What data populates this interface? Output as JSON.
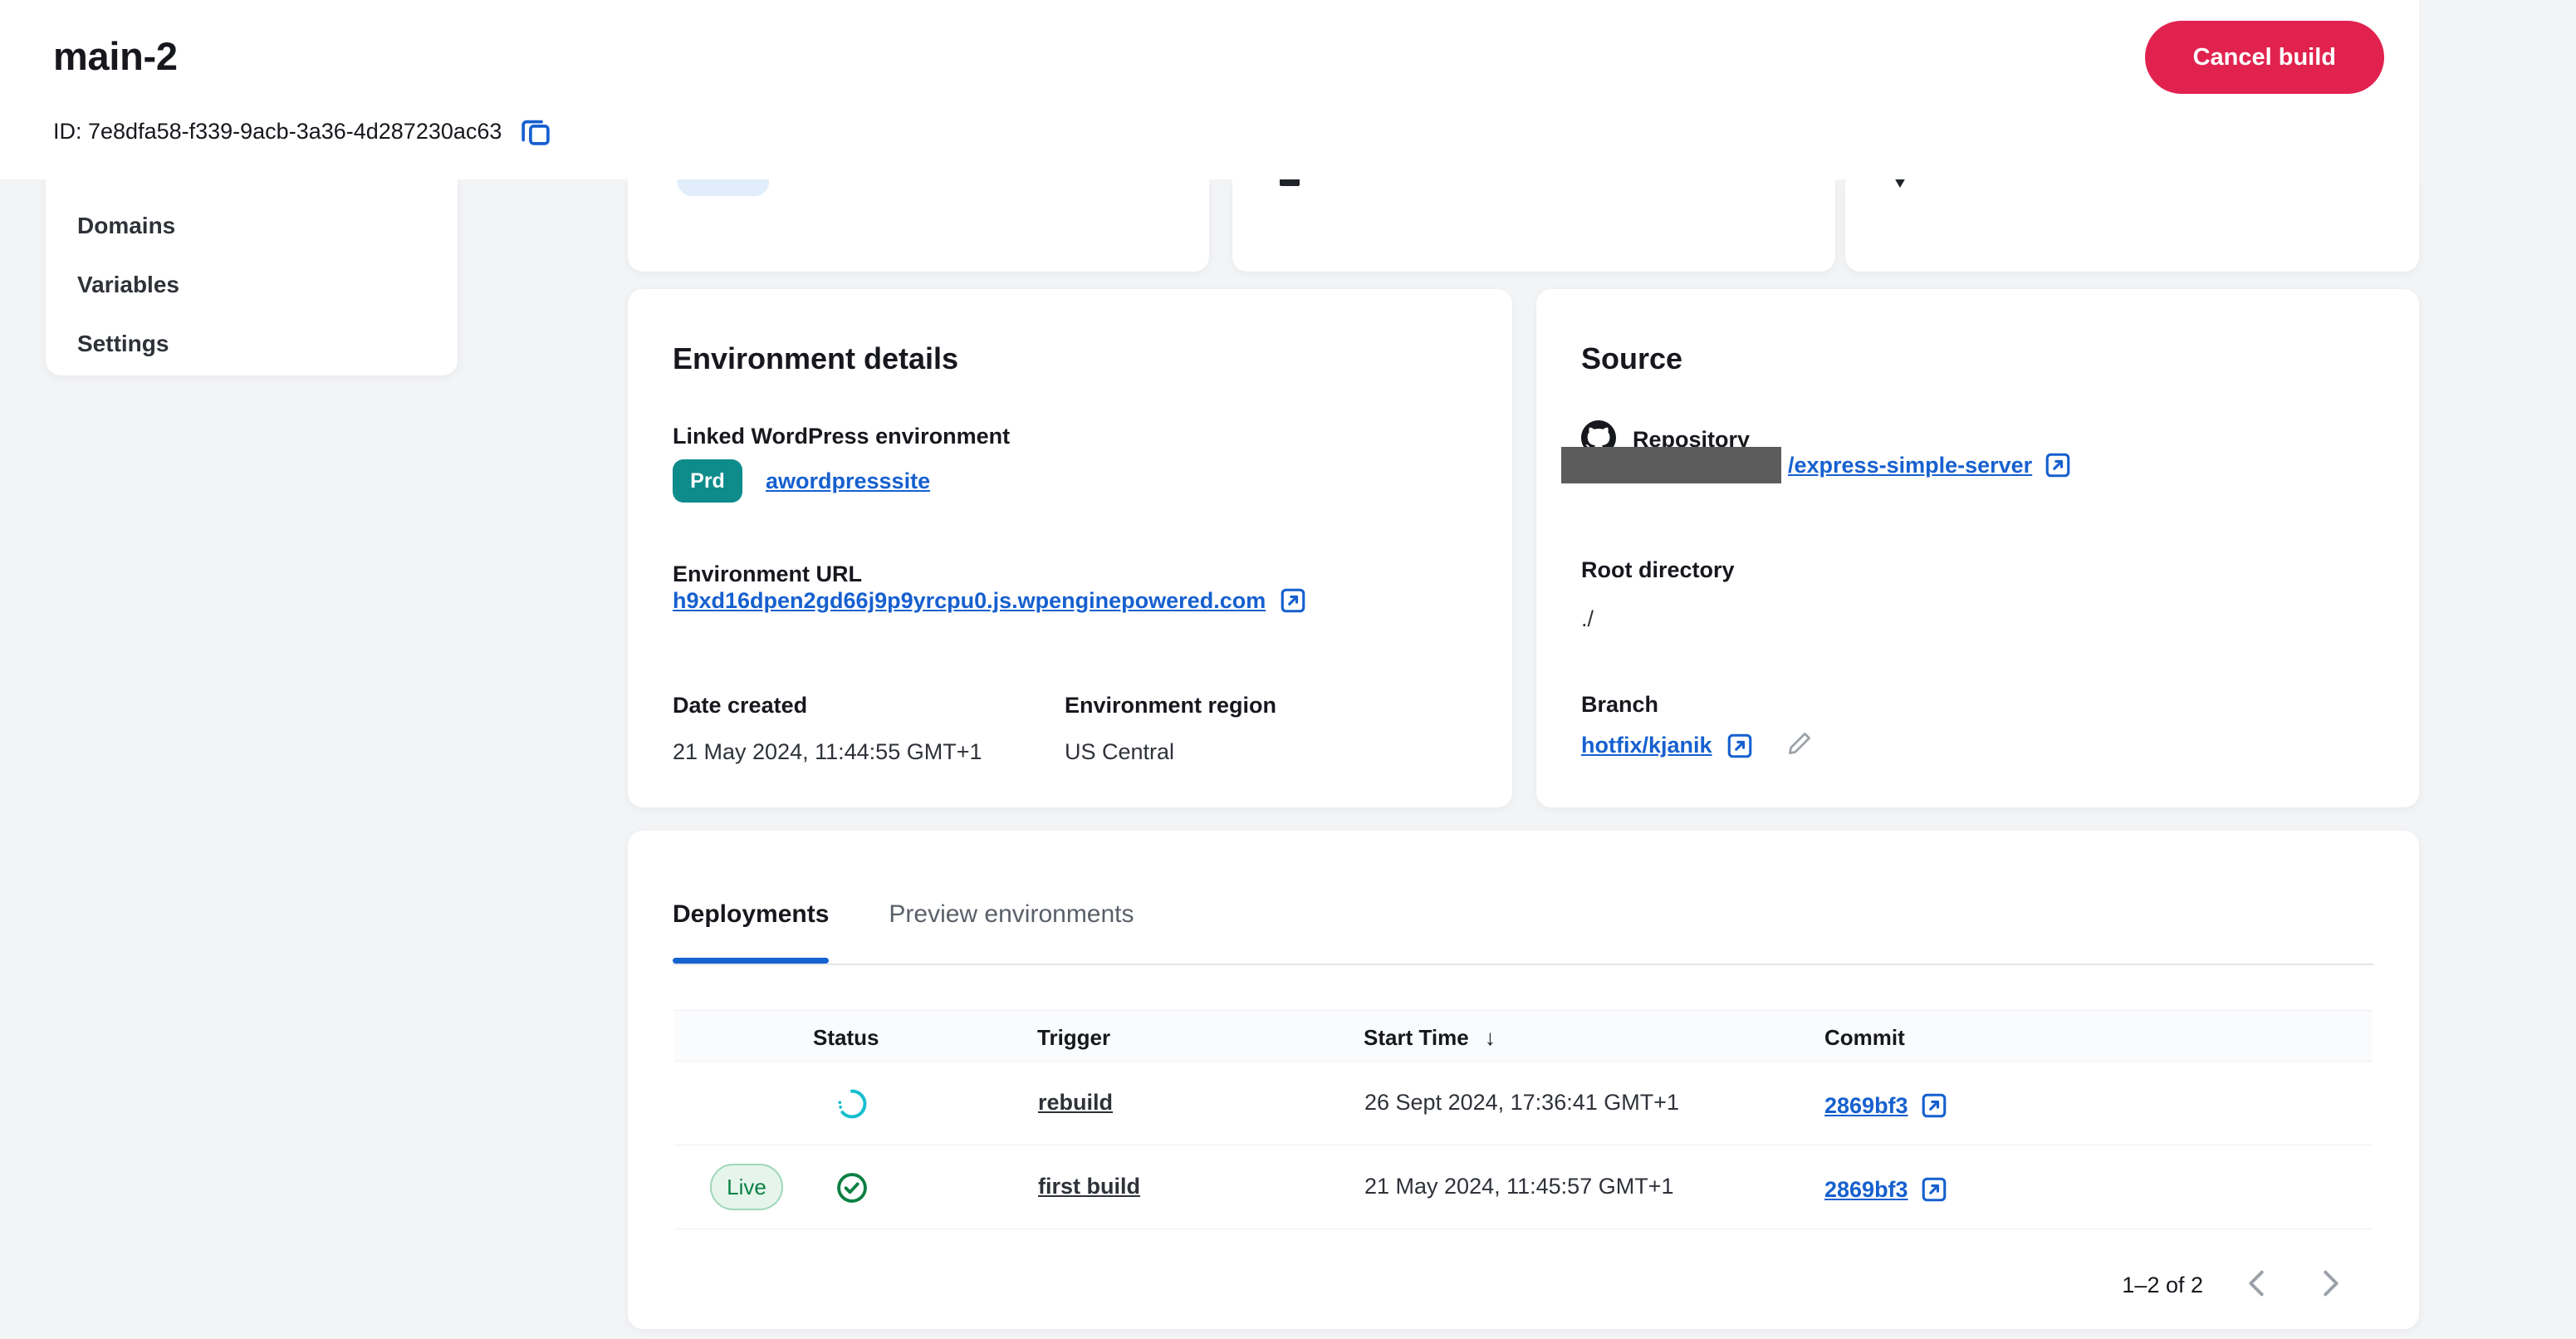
{
  "header": {
    "title": "main-2",
    "id_text": "ID: 7e8dfa58-f339-9acb-3a36-4d287230ac63",
    "copy_icon": "copy-icon",
    "cancel_label": "Cancel build"
  },
  "sidebar": {
    "items": [
      {
        "label": "Domains"
      },
      {
        "label": "Variables"
      },
      {
        "label": "Settings"
      }
    ]
  },
  "environment_details": {
    "title": "Environment details",
    "linked_wp_label": "Linked WordPress environment",
    "linked_wp_badge": "Prd",
    "linked_wp_site": "awordpresssite",
    "env_url_label": "Environment URL",
    "env_url": "h9xd16dpen2gd66j9p9yrcpu0.js.wpenginepowered.com",
    "date_created_label": "Date created",
    "date_created": "21 May 2024, 11:44:55 GMT+1",
    "region_label": "Environment region",
    "region": "US Central"
  },
  "source": {
    "title": "Source",
    "repository_label": "Repository",
    "repo_icon": "github-icon",
    "repo_owner_redacted": "",
    "repo_name": "/express-simple-server",
    "root_directory_label": "Root directory",
    "root_directory": "./",
    "branch_label": "Branch",
    "branch": "hotfix/kjanik",
    "edit_icon": "pencil-icon"
  },
  "deployments_panel": {
    "tabs": [
      {
        "label": "Deployments",
        "active": true
      },
      {
        "label": "Preview environments",
        "active": false
      }
    ],
    "columns": [
      "",
      "Status",
      "Trigger",
      "Start Time",
      "Commit"
    ],
    "sort_indicator": "↓",
    "rows": [
      {
        "live_badge": "",
        "status_icon": "spinner-icon",
        "trigger": "rebuild",
        "start_time": "26 Sept 2024, 17:36:41 GMT+1",
        "commit": "2869bf3"
      },
      {
        "live_badge": "Live",
        "status_icon": "check-circle-icon",
        "trigger": "first build",
        "start_time": "21 May 2024, 11:45:57 GMT+1",
        "commit": "2869bf3"
      }
    ],
    "pagination": {
      "range": "1–2 of 2",
      "prev_icon": "chevron-left-icon",
      "next_icon": "chevron-right-icon"
    }
  },
  "colors": {
    "accent_blue": "#1660cf",
    "danger": "#e1224f",
    "teal": "#0e8b8b",
    "green": "#0a8043",
    "spinner": "#16becf",
    "page_bg": "#f3f4f6"
  }
}
